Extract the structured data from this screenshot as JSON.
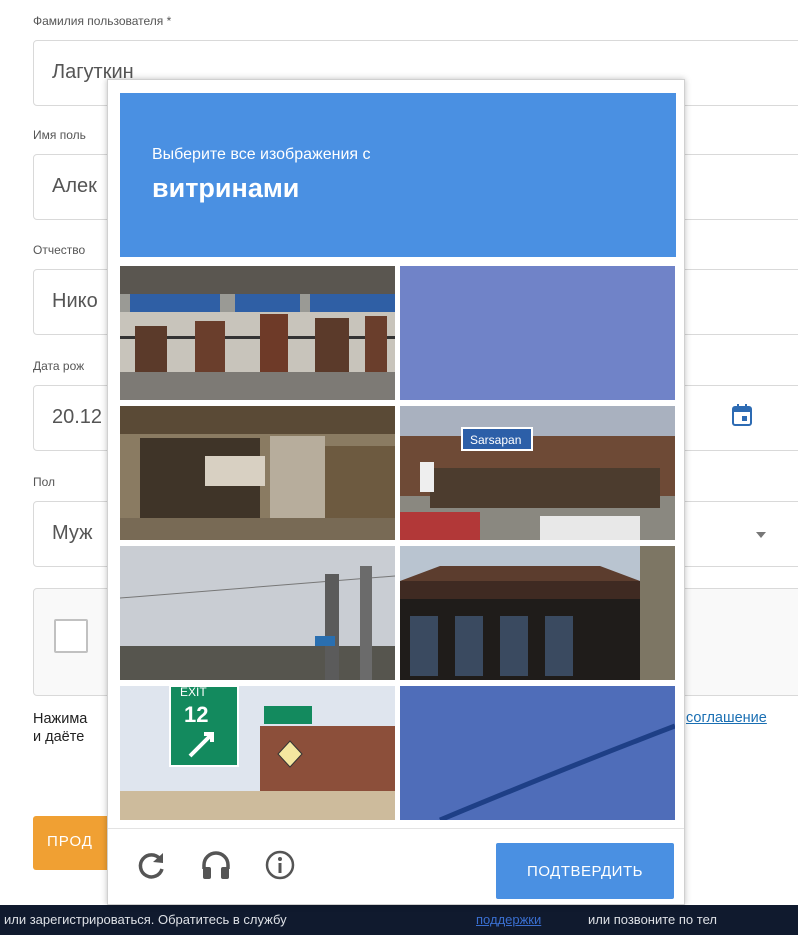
{
  "form": {
    "lastname_label": "Фамилия пользователя *",
    "lastname_value": "Лагуткин",
    "firstname_label": "Имя поль",
    "firstname_value": "Алек",
    "patronymic_label": "Отчество",
    "patronymic_value": "Нико",
    "birthdate_label": "Дата рож",
    "birthdate_value": "20.12",
    "gender_label": "Пол",
    "gender_value": "Муж",
    "agree_line1": "Нажима",
    "agree_line2": "и даёте",
    "agree_link": "соглашение",
    "continue_label": "ПРОД"
  },
  "footer": {
    "text_before": "или зарегистрироваться. Обратитесь в службу",
    "link": "поддержки",
    "text_after": "или позвоните по тел"
  },
  "captcha": {
    "instruction": "Выберите все изображения с",
    "keyword": "витринами",
    "verify_label": "ПОДТВЕРДИТЬ",
    "tiles": [
      {
        "content": "cafe-storefront"
      },
      {
        "content": "sky"
      },
      {
        "content": "shop-front"
      },
      {
        "content": "bakery-storefront"
      },
      {
        "content": "road-sign-pole"
      },
      {
        "content": "restaurant-building"
      },
      {
        "content": "highway-exit-sign"
      },
      {
        "content": "blue-sky-wire"
      }
    ],
    "tile_sign_text": {
      "exit": "EXIT",
      "exit_num": "12",
      "shop_sign": "Sarsapan"
    }
  },
  "icons": {
    "reload": "reload-icon",
    "audio": "headphones-icon",
    "info": "info-icon",
    "calendar": "calendar-icon",
    "dropdown": "chevron-down-icon"
  },
  "colors": {
    "captcha_blue": "#4a90e2",
    "continue_orange": "#f0a033",
    "footer_bg": "#101a2e"
  }
}
